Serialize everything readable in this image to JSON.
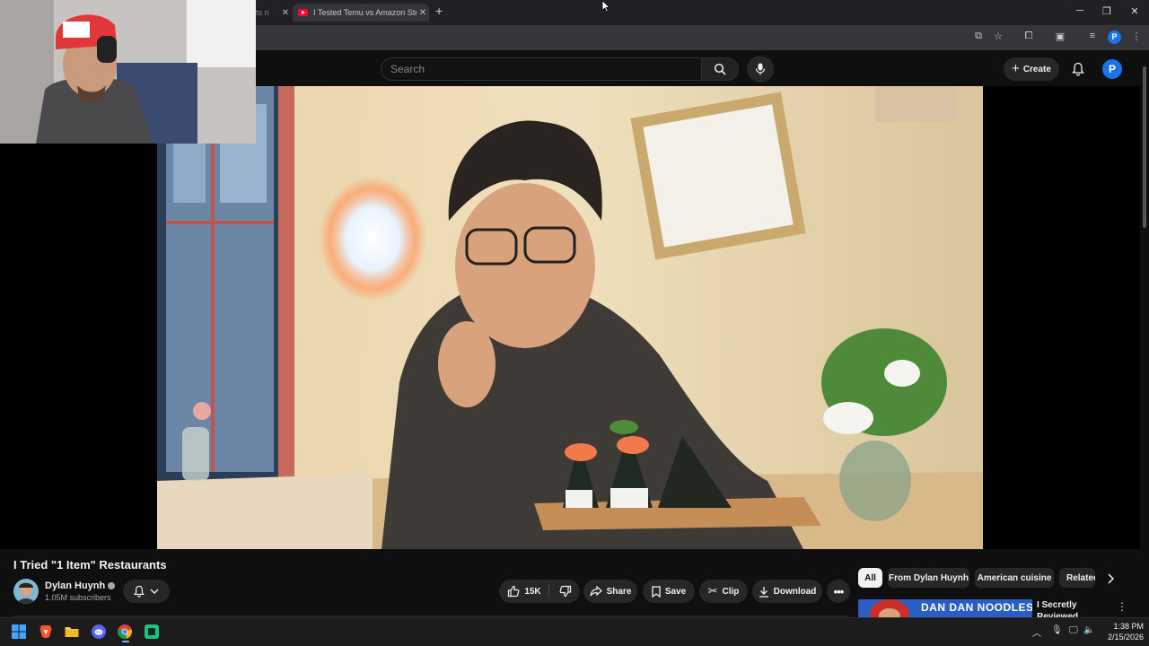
{
  "browser": {
    "tabs": [
      {
        "label": "ts n",
        "active": false
      },
      {
        "label": "I Tested Temu vs Amazon Steak",
        "active": true
      }
    ],
    "new_tab_icon": "plus-icon",
    "profile_letter": "P"
  },
  "header": {
    "search_placeholder": "Search",
    "create_label": "Create",
    "avatar_letter": "P"
  },
  "video": {
    "title": "I Tried \"1 Item\" Restaurants",
    "channel_name": "Dylan Huynh",
    "subscribers": "1.05M subscribers",
    "likes": "15K",
    "actions": {
      "share": "Share",
      "save": "Save",
      "clip": "Clip",
      "download": "Download"
    }
  },
  "sidebar": {
    "chips": [
      {
        "label": "All",
        "active": true
      },
      {
        "label": "From Dylan Huynh",
        "active": false
      },
      {
        "label": "American cuisine",
        "active": false
      },
      {
        "label": "Relatec",
        "active": false
      }
    ],
    "recommendation": {
      "thumbnail_text": "DAN DAN NOODLES",
      "title": "I Secretly Reviewed Restaurants Askin"
    }
  },
  "taskbar": {
    "time": "1:38 PM",
    "date": "2/15/2026"
  },
  "colors": {
    "youtube_bg": "#0f0f0f",
    "chip_active": "#f1f1f1",
    "accent_blue": "#1a73e8",
    "youtube_red": "#ff0033"
  }
}
